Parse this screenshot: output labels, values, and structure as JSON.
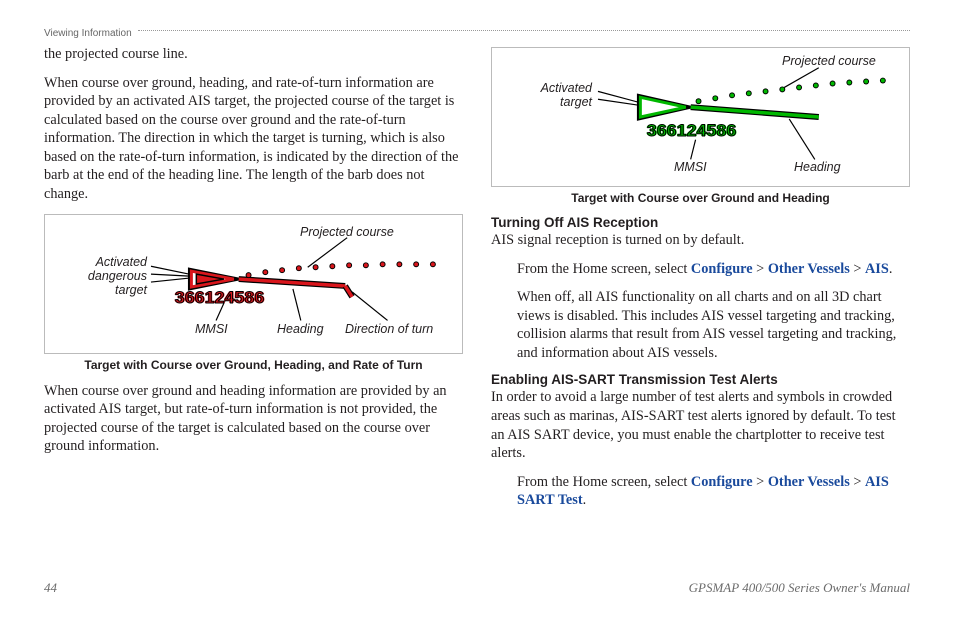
{
  "header": {
    "section": "Viewing Information"
  },
  "left": {
    "p1": "the projected course line.",
    "p2": "When course over ground, heading, and rate-of-turn information are provided by an activated AIS target, the projected course of the target is calculated based on the course over ground and the rate-of-turn information. The direction in which the target is turning, which is also based on the rate-of-turn information, is indicated by the direction of the barb at the end of the heading line. The length of the barb does not change.",
    "fig": {
      "projected": "Projected course",
      "activated": "Activated dangerous target",
      "mmsi_lbl": "MMSI",
      "heading_lbl": "Heading",
      "dir_turn": "Direction of turn",
      "mmsi_num": "366124586"
    },
    "caption1": "Target with Course over Ground, Heading, and Rate of Turn",
    "p3": "When course over ground and heading information are provided by an activated AIS target, but rate-of-turn information is not provided, the projected course of the target is calculated based on the course over ground information."
  },
  "right": {
    "fig": {
      "projected": "Projected course",
      "activated": "Activated target",
      "mmsi_lbl": "MMSI",
      "heading_lbl": "Heading",
      "mmsi_num": "366124586"
    },
    "caption2": "Target with Course over Ground and Heading",
    "h1": "Turning Off AIS Reception",
    "p1": "AIS signal reception is turned on by default.",
    "step1_pre": "From the Home screen, select ",
    "configure": "Configure",
    "othervessels": "Other Vessels",
    "ais": "AIS",
    "sep": " > ",
    "dot": ".",
    "p2": "When off, all AIS functionality on all charts and on all 3D chart views is disabled. This includes AIS vessel targeting and tracking, collision alarms that result from AIS vessel targeting and tracking, and information about AIS vessels.",
    "h2": "Enabling AIS-SART Transmission Test Alerts",
    "p3": "In order to avoid a large number of test alerts and symbols in crowded areas such as marinas, AIS-SART test alerts ignored by default. To test an AIS SART device, you must enable the chartplotter to receive test alerts.",
    "step2_pre": "From the Home screen, select ",
    "aissart": "AIS SART Test"
  },
  "footer": {
    "page": "44",
    "manual": "GPSMAP 400/500 Series Owner's Manual"
  }
}
